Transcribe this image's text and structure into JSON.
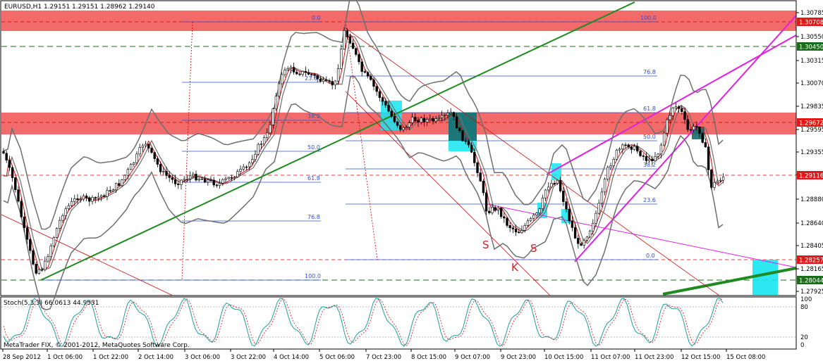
{
  "header": {
    "main_title": "EURUSD,H1  1.29151  1.29151  1.28962  1.29140",
    "stoch_title": "Stoch(5,3,3) 66.0613 44.9531",
    "copyright": "MetaTrader FIX, © 2001-2012, MetaQuotes Software Corp."
  },
  "price_axis": {
    "ticks": [
      "1.30785",
      "1.30550",
      "1.30315",
      "1.30070",
      "1.29835",
      "1.29595",
      "1.29355",
      "1.29115",
      "1.28880",
      "1.28640",
      "1.28405",
      "1.28165",
      "1.27925"
    ],
    "tag_labels": [
      "1.30708",
      "1.30450",
      "1.29672",
      "1.29116",
      "1.28257",
      "1.28044"
    ],
    "tag_colors": [
      "#e01818",
      "#1a6b1a",
      "#e01818",
      "#e01818",
      "#e01818",
      "#1a6b1a"
    ]
  },
  "stoch_axis": {
    "ticks": [
      "100",
      "80",
      "20",
      "0"
    ]
  },
  "time_axis": {
    "labels": [
      "28 Sep 2012",
      "1 Oct 06:00",
      "1 Oct 22:00",
      "2 Oct 14:00",
      "3 Oct 06:00",
      "3 Oct 22:00",
      "4 Oct 14:00",
      "5 Oct 06:00",
      "7 Oct 23:00",
      "8 Oct 15:00",
      "9 Oct 07:00",
      "9 Oct 23:00",
      "10 Oct 15:00",
      "11 Oct 07:00",
      "11 Oct 23:00",
      "12 Oct 15:00",
      "15 Oct 08:00"
    ]
  },
  "fib_left": {
    "labels": [
      "0.0",
      "23.6",
      "38.2",
      "50.0",
      "61.8",
      "76.8",
      "100.0"
    ]
  },
  "fib_right": {
    "labels": [
      "100.0",
      "76.8",
      "61.8",
      "50.0",
      "38.2",
      "23.6",
      "0.0"
    ]
  },
  "pattern_labels": {
    "left_shoulder": "S",
    "head": "K",
    "right_shoulder": "S"
  },
  "colors": {
    "resistance_zone": "#f25a5a",
    "cyan_box": "#16e5f0",
    "dark_teal_box": "#1a6b6b",
    "trendline_green": "#1f8a1f",
    "channel_magenta": "#e020e0",
    "fib_blue": "#2b4fd6",
    "ma_red": "#cc1111",
    "bollinger_gray": "#6e6e6e"
  }
}
